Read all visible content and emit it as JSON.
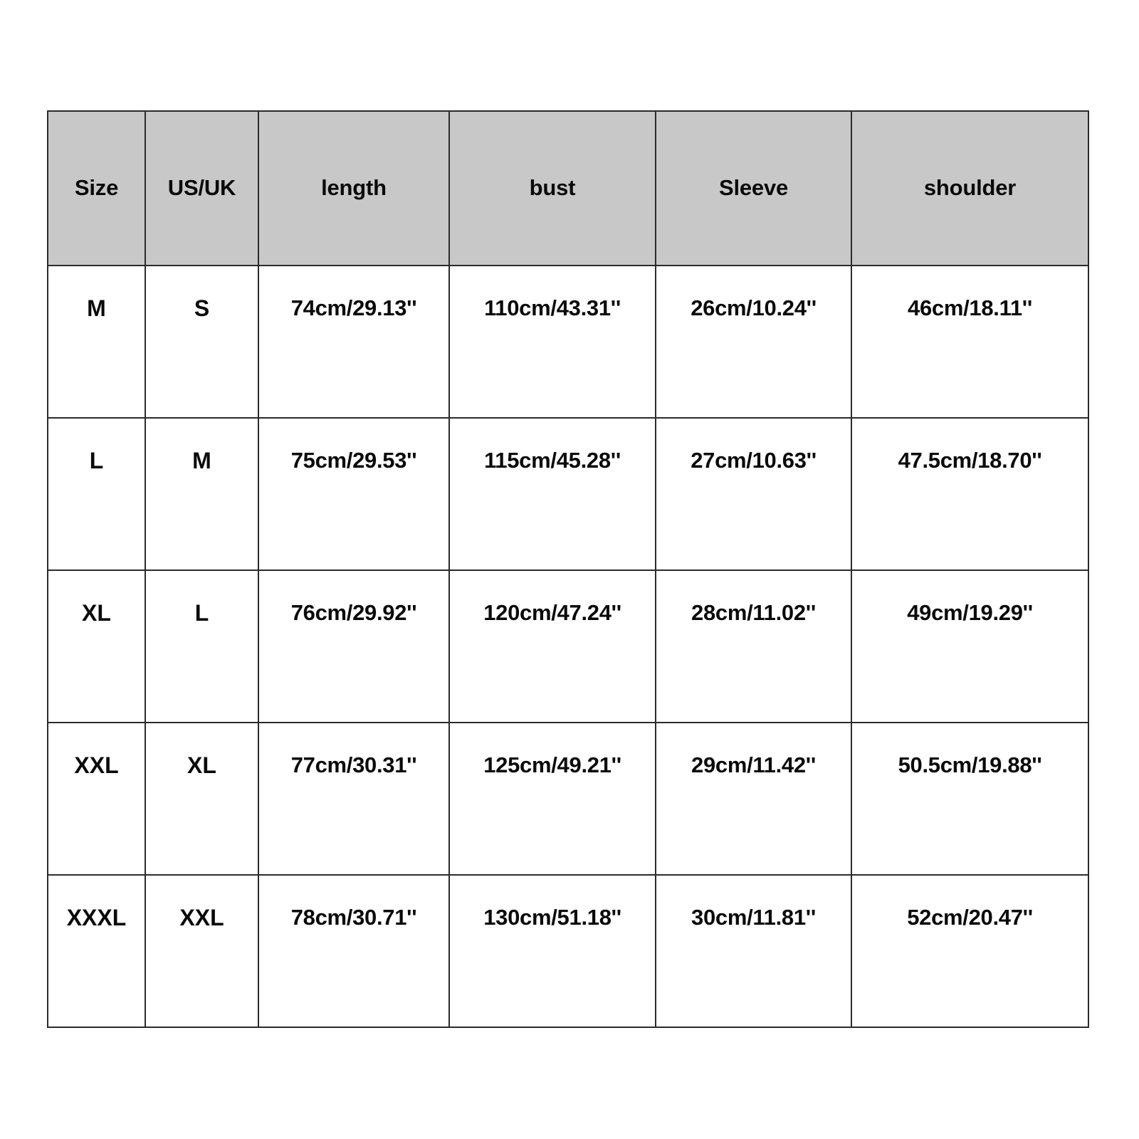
{
  "table": {
    "headers": [
      {
        "key": "size",
        "label": "Size"
      },
      {
        "key": "us_uk",
        "label": "US/UK"
      },
      {
        "key": "length",
        "label": "length"
      },
      {
        "key": "bust",
        "label": "bust"
      },
      {
        "key": "sleeve",
        "label": "Sleeve"
      },
      {
        "key": "shoulder",
        "label": "shoulder"
      }
    ],
    "rows": [
      {
        "size": "M",
        "us_uk": "S",
        "length": "74cm/29.13''",
        "bust": "110cm/43.31''",
        "sleeve": "26cm/10.24''",
        "shoulder": "46cm/18.11''"
      },
      {
        "size": "L",
        "us_uk": "M",
        "length": "75cm/29.53''",
        "bust": "115cm/45.28''",
        "sleeve": "27cm/10.63''",
        "shoulder": "47.5cm/18.70''"
      },
      {
        "size": "XL",
        "us_uk": "L",
        "length": "76cm/29.92''",
        "bust": "120cm/47.24''",
        "sleeve": "28cm/11.02''",
        "shoulder": "49cm/19.29''"
      },
      {
        "size": "XXL",
        "us_uk": "XL",
        "length": "77cm/30.31''",
        "bust": "125cm/49.21''",
        "sleeve": "29cm/11.42''",
        "shoulder": "50.5cm/19.88''"
      },
      {
        "size": "XXXL",
        "us_uk": "XXL",
        "length": "78cm/30.71''",
        "bust": "130cm/51.18''",
        "sleeve": "30cm/11.81''",
        "shoulder": "52cm/20.47''"
      }
    ]
  },
  "colors": {
    "header_background": "#c8c8c8",
    "cell_background": "#ffffff",
    "border": "#2b2b2b",
    "text": "#0a0a0a",
    "page_background": "#ffffff"
  },
  "chart_data": {
    "type": "table",
    "title": "",
    "columns": [
      "Size",
      "US/UK",
      "length",
      "bust",
      "Sleeve",
      "shoulder"
    ],
    "rows": [
      [
        "M",
        "S",
        "74cm/29.13''",
        "110cm/43.31''",
        "26cm/10.24''",
        "46cm/18.11''"
      ],
      [
        "L",
        "M",
        "75cm/29.53''",
        "115cm/45.28''",
        "27cm/10.63''",
        "47.5cm/18.70''"
      ],
      [
        "XL",
        "L",
        "76cm/29.92''",
        "120cm/47.24''",
        "28cm/11.02''",
        "49cm/19.29''"
      ],
      [
        "XXL",
        "XL",
        "77cm/30.31''",
        "125cm/49.21''",
        "29cm/11.42''",
        "50.5cm/19.88''"
      ],
      [
        "XXXL",
        "XXL",
        "78cm/30.71''",
        "130cm/51.18''",
        "30cm/11.81''",
        "52cm/20.47''"
      ]
    ]
  }
}
